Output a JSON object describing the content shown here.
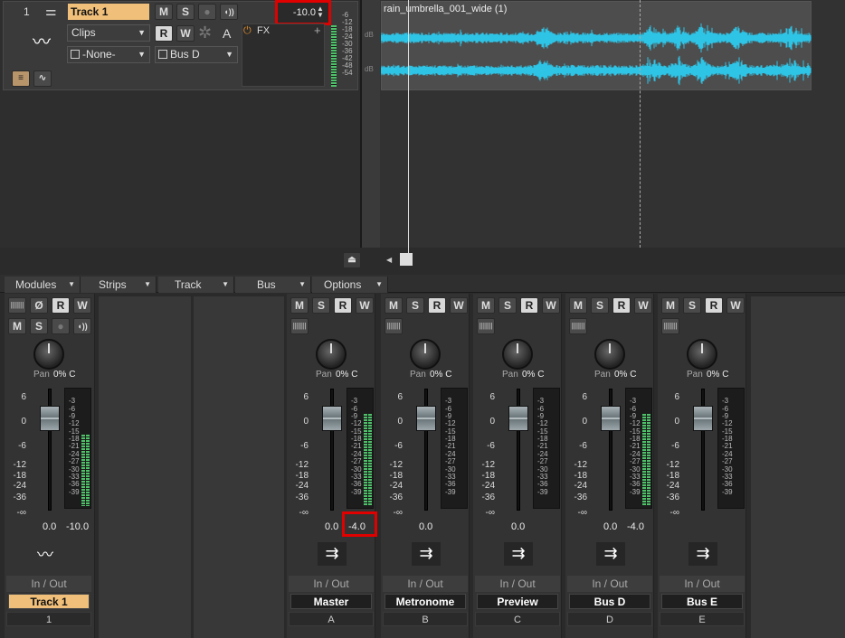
{
  "track": {
    "number": "1",
    "name": "Track 1",
    "clips_select": "Clips",
    "input_select": "-None-",
    "output_select": "Bus D",
    "volume": "-10.0",
    "fx_label": "FX",
    "buttons": {
      "m": "M",
      "s": "S",
      "r": "R",
      "w": "W",
      "a": "A"
    },
    "meter_scale": [
      "-6",
      "-12",
      "-18",
      "-24",
      "-30",
      "-36",
      "-42",
      "-48",
      "-54"
    ]
  },
  "clip": {
    "title": "rain_umbrella_001_wide (1)",
    "db_label_1": "dB",
    "db_label_2": "dB"
  },
  "tabs": [
    "Modules",
    "Strips",
    "Track",
    "Bus",
    "Options"
  ],
  "pan_label": "Pan",
  "pan_value": "0% C",
  "fader_scale": [
    "6",
    "0",
    "-6",
    "-12",
    "-18",
    "-24",
    "-36",
    "-∞"
  ],
  "meter_scale": [
    "-3",
    "-6",
    "-9",
    "-12",
    "-15",
    "-18",
    "-21",
    "-24",
    "-27",
    "-30",
    "-33",
    "-36",
    "-39"
  ],
  "in_out_label": "In / Out",
  "strips": [
    {
      "name": "Track 1",
      "letter": "1",
      "vol": "0.0",
      "peak": "-10.0",
      "selected": true,
      "meter": 0.62
    },
    {
      "name": "Master",
      "letter": "A",
      "vol": "0.0",
      "peak": "-4.0",
      "selected": false,
      "meter": 0.8
    },
    {
      "name": "Metronome",
      "letter": "B",
      "vol": "0.0",
      "peak": "",
      "selected": false,
      "meter": 0
    },
    {
      "name": "Preview",
      "letter": "C",
      "vol": "0.0",
      "peak": "",
      "selected": false,
      "meter": 0
    },
    {
      "name": "Bus D",
      "letter": "D",
      "vol": "0.0",
      "peak": "-4.0",
      "selected": false,
      "meter": 0.8
    },
    {
      "name": "Bus E",
      "letter": "E",
      "vol": "",
      "peak": "",
      "selected": false,
      "meter": 0
    }
  ],
  "colors": {
    "accent": "#f0c07a",
    "waveform": "#2ec4e6",
    "meter": "#4ec36a",
    "highlight": "#e00000"
  }
}
